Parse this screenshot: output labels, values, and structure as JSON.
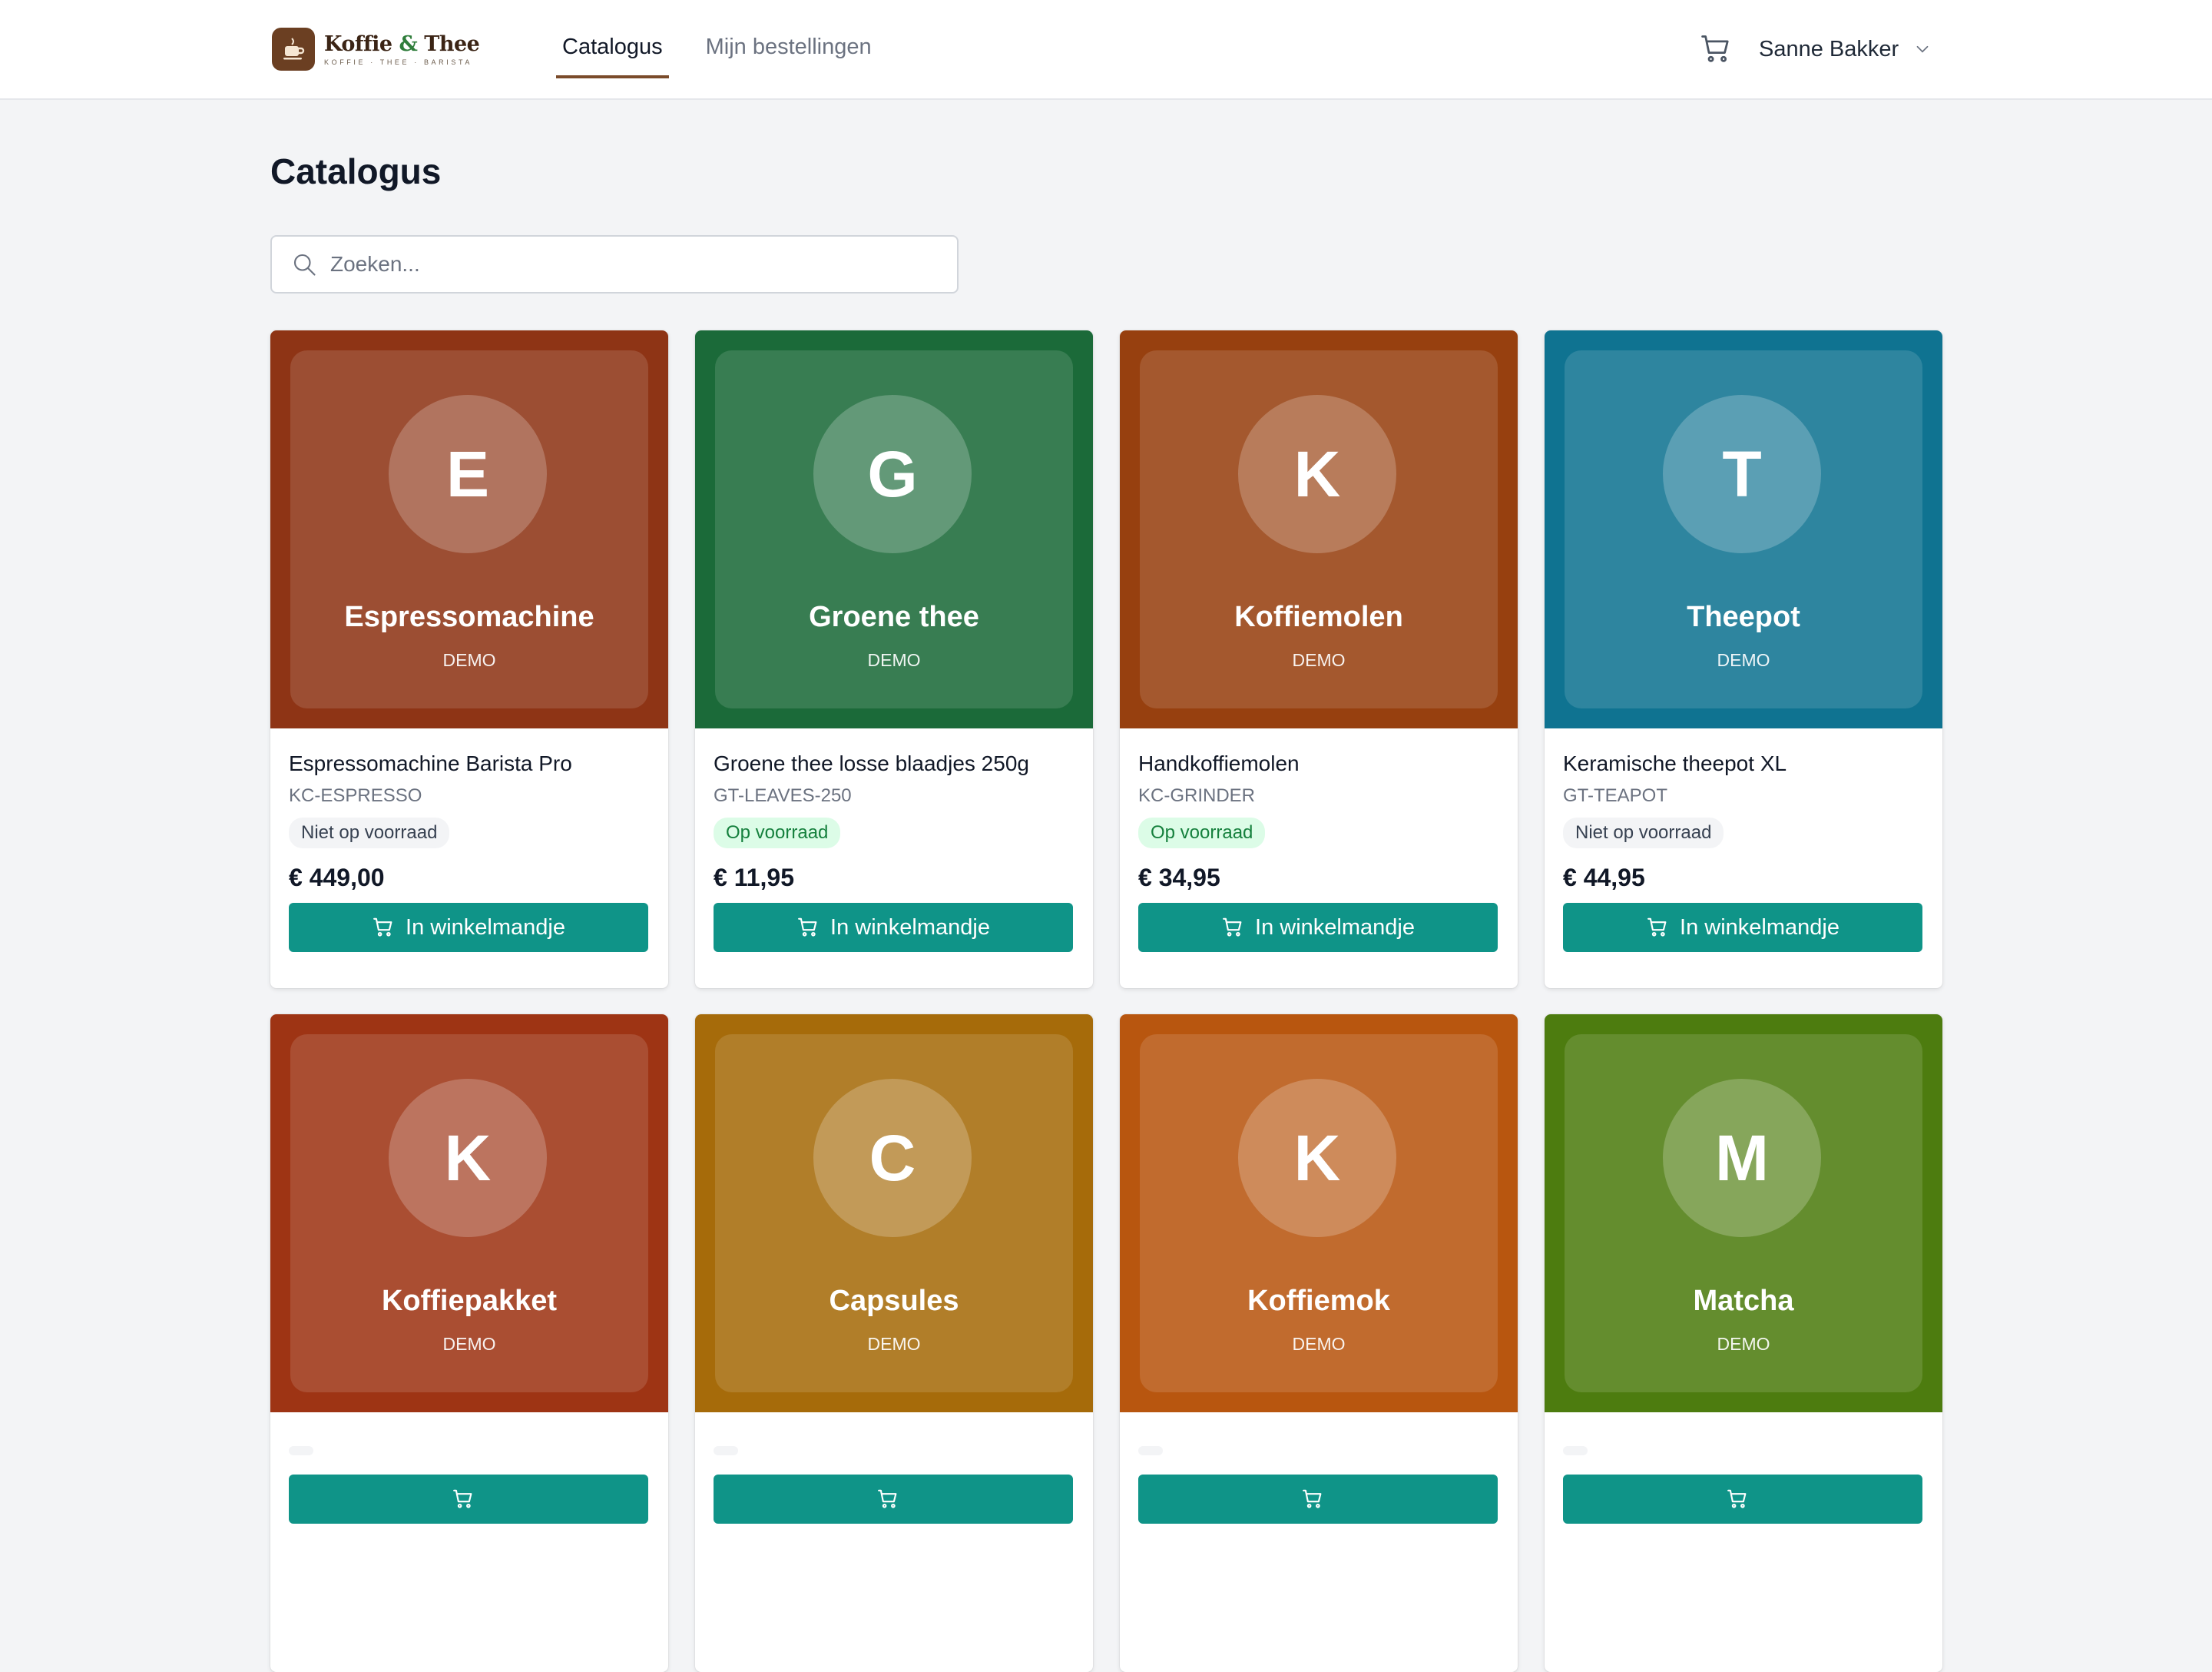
{
  "brand": {
    "title_part1": "Koffie",
    "title_amp": "&",
    "title_part2": "Thee",
    "tagline": "KOFFIE · THEE · BARISTA"
  },
  "nav": {
    "tabs": [
      {
        "label": "Catalogus",
        "active": true
      },
      {
        "label": "Mijn bestellingen",
        "active": false
      }
    ]
  },
  "user": {
    "name": "Sanne Bakker"
  },
  "icons": {
    "cart": "cart-icon",
    "user_menu": "chevron-down-icon",
    "search": "search-icon"
  },
  "page": {
    "title": "Catalogus"
  },
  "search": {
    "placeholder": "Zoeken...",
    "value": ""
  },
  "colors": {
    "accent": "#0f9488",
    "brand": "#6b3f22"
  },
  "products": [
    {
      "letter": "E",
      "image_title": "Espressomachine",
      "image_tag": "DEMO",
      "color": "#8e3415",
      "name": "Espressomachine Barista Pro",
      "sku": "KC-ESPRESSO",
      "stock": "Niet op voorraad",
      "in_stock": false,
      "price": "€ 449,00",
      "button": "In winkelmandje"
    },
    {
      "letter": "G",
      "image_title": "Groene thee",
      "image_tag": "DEMO",
      "color": "#1b6a39",
      "name": "Groene thee losse blaadjes 250g",
      "sku": "GT-LEAVES-250",
      "stock": "Op voorraad",
      "in_stock": true,
      "price": "€ 11,95",
      "button": "In winkelmandje"
    },
    {
      "letter": "K",
      "image_title": "Koffiemolen",
      "image_tag": "DEMO",
      "color": "#97400f",
      "name": "Handkoffiemolen",
      "sku": "KC-GRINDER",
      "stock": "Op voorraad",
      "in_stock": true,
      "price": "€ 34,95",
      "button": "In winkelmandje"
    },
    {
      "letter": "T",
      "image_title": "Theepot",
      "image_tag": "DEMO",
      "color": "#0f7391",
      "name": "Keramische theepot XL",
      "sku": "GT-TEAPOT",
      "stock": "Niet op voorraad",
      "in_stock": false,
      "price": "€ 44,95",
      "button": "In winkelmandje"
    },
    {
      "letter": "K",
      "image_title": "Koffiepakket",
      "image_tag": "DEMO",
      "color": "#9e3414",
      "name": "",
      "sku": "",
      "stock": "",
      "in_stock": false,
      "price": "",
      "button": ""
    },
    {
      "letter": "C",
      "image_title": "Capsules",
      "image_tag": "DEMO",
      "color": "#a66b0a",
      "name": "",
      "sku": "",
      "stock": "",
      "in_stock": false,
      "price": "",
      "button": ""
    },
    {
      "letter": "K",
      "image_title": "Koffiemok",
      "image_tag": "DEMO",
      "color": "#b8560f",
      "name": "",
      "sku": "",
      "stock": "",
      "in_stock": false,
      "price": "",
      "button": ""
    },
    {
      "letter": "M",
      "image_title": "Matcha",
      "image_tag": "DEMO",
      "color": "#4d7c0f",
      "name": "",
      "sku": "",
      "stock": "",
      "in_stock": false,
      "price": "",
      "button": ""
    }
  ]
}
